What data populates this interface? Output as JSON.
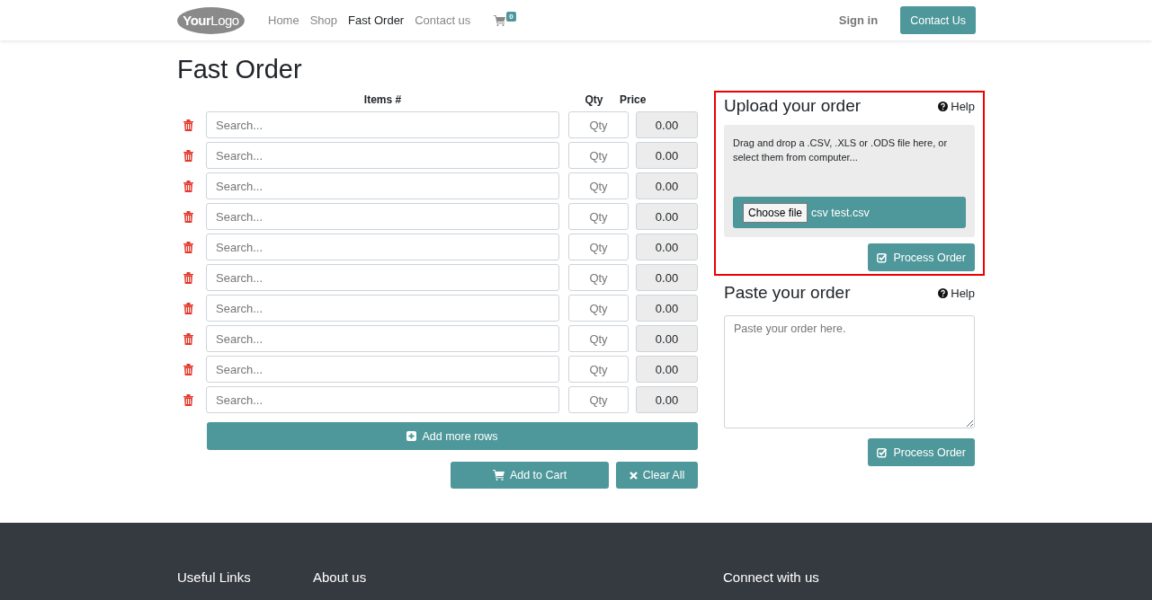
{
  "header": {
    "logo": "**Your**Logo",
    "nav": [
      {
        "label": "Home",
        "selected": false
      },
      {
        "label": "Shop",
        "selected": false
      },
      {
        "label": "Fast Order",
        "selected": true
      },
      {
        "label": "Contact us",
        "selected": false
      }
    ],
    "cart_count": "0",
    "sign_in": "Sign in",
    "contact_button": "Contact Us"
  },
  "page_title": "Fast Order",
  "order_table": {
    "columns": [
      "Items #",
      "Qty",
      "Price"
    ],
    "rows": [
      {
        "item_placeholder": "Search...",
        "qty_placeholder": "Qty",
        "price": "0.00"
      },
      {
        "item_placeholder": "Search...",
        "qty_placeholder": "Qty",
        "price": "0.00"
      },
      {
        "item_placeholder": "Search...",
        "qty_placeholder": "Qty",
        "price": "0.00"
      },
      {
        "item_placeholder": "Search...",
        "qty_placeholder": "Qty",
        "price": "0.00"
      },
      {
        "item_placeholder": "Search...",
        "qty_placeholder": "Qty",
        "price": "0.00"
      },
      {
        "item_placeholder": "Search...",
        "qty_placeholder": "Qty",
        "price": "0.00"
      },
      {
        "item_placeholder": "Search...",
        "qty_placeholder": "Qty",
        "price": "0.00"
      },
      {
        "item_placeholder": "Search...",
        "qty_placeholder": "Qty",
        "price": "0.00"
      },
      {
        "item_placeholder": "Search...",
        "qty_placeholder": "Qty",
        "price": "0.00"
      },
      {
        "item_placeholder": "Search...",
        "qty_placeholder": "Qty",
        "price": "0.00"
      }
    ],
    "add_rows_button": "Add more rows",
    "add_to_cart_button": "Add to Cart",
    "clear_all_button": "Clear All"
  },
  "upload": {
    "title": "Upload your order",
    "help": "Help",
    "instructions": "Drag and drop a .CSV, .XLS or .ODS file here, or select them from computer...",
    "choose_file_button": "Choose file",
    "file_name": "csv test.csv",
    "process_button": "Process Order"
  },
  "paste": {
    "title": "Paste your order",
    "help": "Help",
    "placeholder": "Paste your order here.",
    "process_button": "Process Order"
  },
  "footer": {
    "columns": [
      "Useful Links",
      "About us",
      "Connect with us"
    ]
  }
}
